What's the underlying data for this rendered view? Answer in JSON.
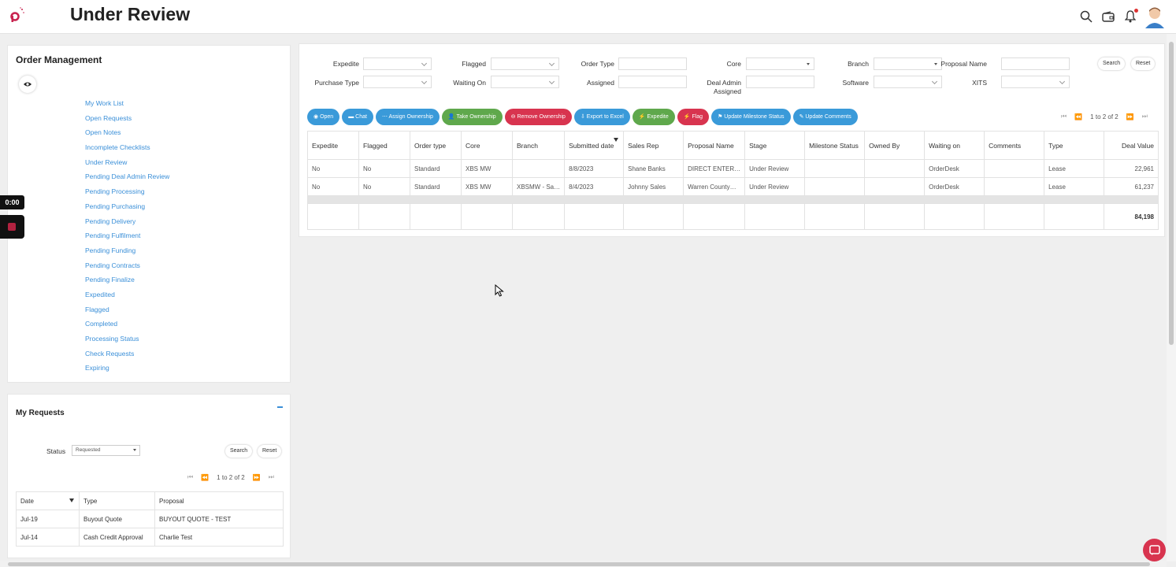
{
  "header": {
    "title": "Under Review"
  },
  "order_management": {
    "title": "Order Management",
    "items": [
      "My Work List",
      "Open Requests",
      "Open Notes",
      "Incomplete Checklists",
      "Under Review",
      "Pending Deal Admin Review",
      "Pending Processing",
      "Pending Purchasing",
      "Pending Delivery",
      "Pending Fulfilment",
      "Pending Funding",
      "Pending Contracts",
      "Pending Finalize",
      "Expedited",
      "Flagged",
      "Completed",
      "Processing Status",
      "Check Requests",
      "Expiring"
    ]
  },
  "my_requests": {
    "title": "My Requests",
    "status_label": "Status",
    "status_value": "Requested",
    "search_label": "Search",
    "reset_label": "Reset",
    "pager_text": "1 to 2 of 2",
    "columns": [
      "Date",
      "Type",
      "Proposal"
    ],
    "rows": [
      [
        "Jul-19",
        "Buyout Quote",
        "BUYOUT QUOTE - TEST"
      ],
      [
        "Jul-14",
        "Cash Credit Approval",
        "Charlie Test"
      ]
    ]
  },
  "filters": {
    "expedite": "Expedite",
    "flagged": "Flagged",
    "order_type": "Order Type",
    "core": "Core",
    "branch": "Branch",
    "proposal_name": "Proposal Name",
    "purchase_type": "Purchase Type",
    "waiting_on": "Waiting On",
    "assigned": "Assigned",
    "deal_admin": "Deal Admin Assigned",
    "software": "Software",
    "xits": "XITS",
    "search_label": "Search",
    "reset_label": "Reset"
  },
  "actions": [
    "Open",
    "Chat",
    "Assign Ownership",
    "Take Ownership",
    "Remove Ownership",
    "Export to Excel",
    "Expedite",
    "Flag",
    "Update Milestone Status",
    "Update Comments"
  ],
  "grid": {
    "pager_text": "1 to 2 of 2",
    "columns": [
      "Expedite",
      "Flagged",
      "Order type",
      "Core",
      "Branch",
      "Submitted date",
      "Sales Rep",
      "Proposal Name",
      "Stage",
      "Milestone Status",
      "Owned By",
      "Waiting on",
      "Comments",
      "Type",
      "Deal Value"
    ],
    "rows": [
      [
        "No",
        "No",
        "Standard",
        "XBS MW",
        "",
        "8/8/2023",
        "Shane Banks",
        "DIRECT ENTER…",
        "Under Review",
        "",
        "",
        "OrderDesk",
        "",
        "Lease",
        "22,961"
      ],
      [
        "No",
        "No",
        "Standard",
        "XBS MW",
        "XBSMW - Sa…",
        "8/4/2023",
        "Johnny Sales",
        "Warren County…",
        "Under Review",
        "",
        "",
        "OrderDesk",
        "",
        "Lease",
        "61,237"
      ]
    ],
    "total": "84,198"
  },
  "recorder": {
    "time": "0:00"
  },
  "colors": {
    "accent": "#3a9ad9",
    "green": "#5fa84c",
    "red": "#d8344f",
    "link": "#3a8fd8"
  }
}
